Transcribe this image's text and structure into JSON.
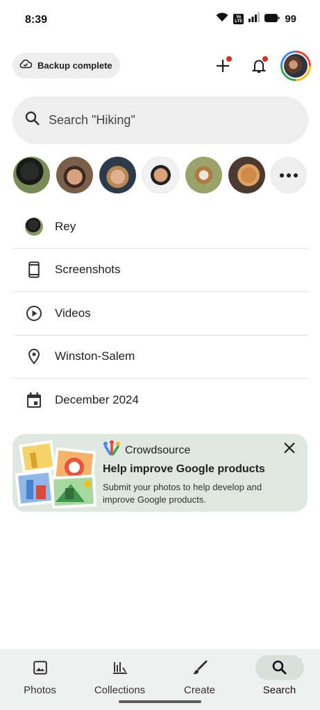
{
  "status_bar": {
    "time": "8:39",
    "volte_line1": "Vo",
    "volte_line2": "LTE",
    "battery": "99"
  },
  "header": {
    "backup_label": "Backup complete",
    "notification_dot_color": "#d93025"
  },
  "search": {
    "placeholder": "Search \"Hiking\""
  },
  "faces": {
    "more_icon": "more-horiz-icon"
  },
  "list": [
    {
      "label": "Rey",
      "icon": "person-thumbnail"
    },
    {
      "label": "Screenshots",
      "icon": "phone-icon"
    },
    {
      "label": "Videos",
      "icon": "play-circle-icon"
    },
    {
      "label": "Winston-Salem",
      "icon": "location-pin-icon"
    },
    {
      "label": "December 2024",
      "icon": "calendar-icon"
    }
  ],
  "card": {
    "brand": "Crowdsource",
    "title": "Help improve Google products",
    "description": "Submit your photos to help develop and improve Google products.",
    "background": "#dfe7e1"
  },
  "bottom_nav": [
    {
      "label": "Photos",
      "icon": "image-icon",
      "active": false
    },
    {
      "label": "Collections",
      "icon": "collections-icon",
      "active": false
    },
    {
      "label": "Create",
      "icon": "brush-icon",
      "active": false
    },
    {
      "label": "Search",
      "icon": "search-icon",
      "active": true
    }
  ]
}
